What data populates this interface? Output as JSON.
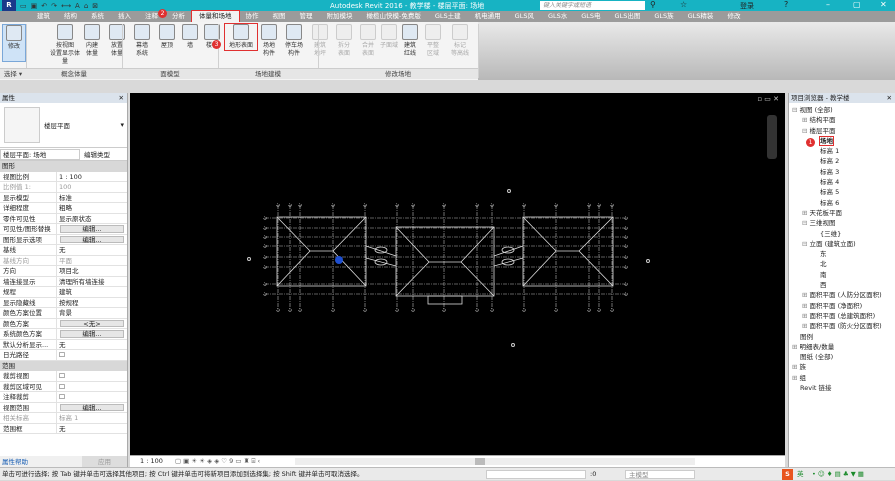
{
  "titlebar": {
    "title": "Autodesk Revit 2016 -    教学楼 - 楼层平面: 场地",
    "search_placeholder": "键入关键字或短语",
    "login": "登录",
    "app_letter": "R"
  },
  "tabs": [
    "建筑",
    "结构",
    "系统",
    "插入",
    "注释",
    "分析",
    "体量和场地",
    "协作",
    "视图",
    "管理",
    "附加模块",
    "橄榄山快模-免费版",
    "GLS土建",
    "机电通用",
    "GLS风",
    "GLS水",
    "GLS电",
    "GLS出图",
    "GLS族",
    "GLS精装",
    "修改"
  ],
  "active_tab": "体量和场地",
  "ribbon": {
    "buttons": [
      {
        "label": "修改"
      },
      {
        "label": "按视图\n设置显示体量"
      },
      {
        "label": "内建\n体量"
      },
      {
        "label": "放置\n体量"
      },
      {
        "label": "幕墙\n系统"
      },
      {
        "label": "屋顶"
      },
      {
        "label": "墙"
      },
      {
        "label": "楼板"
      },
      {
        "label": "地形表面"
      },
      {
        "label": "场地\n构件"
      },
      {
        "label": "停车场\n构件"
      },
      {
        "label": "建筑\n地坪"
      },
      {
        "label": "拆分\n表面"
      },
      {
        "label": "合并\n表面"
      },
      {
        "label": "子面域"
      },
      {
        "label": "建筑\n红线"
      },
      {
        "label": "平整\n区域"
      },
      {
        "label": "标记\n等高线"
      }
    ],
    "panels": [
      "选择 ▾",
      "概念体量",
      "面模型",
      "场地建模",
      "修改场地"
    ]
  },
  "annotations": [
    "1",
    "2",
    "3"
  ],
  "properties": {
    "header": "属性",
    "type_name": "楼层平面",
    "instance": "楼层平面: 场地",
    "edit_type": "编辑类型",
    "section_graphics": "图形",
    "rows": [
      {
        "k": "视图比例",
        "v": "1 : 100"
      },
      {
        "k": "比例值 1:",
        "v": "100",
        "g": true
      },
      {
        "k": "显示模型",
        "v": "标准"
      },
      {
        "k": "详细程度",
        "v": "粗略"
      },
      {
        "k": "零件可见性",
        "v": "显示原状态"
      },
      {
        "k": "可见性/图形替换",
        "b": "编辑..."
      },
      {
        "k": "图形显示选项",
        "b": "编辑..."
      },
      {
        "k": "基线",
        "v": "无"
      },
      {
        "k": "基线方向",
        "v": "平面",
        "g": true
      },
      {
        "k": "方向",
        "v": "项目北"
      },
      {
        "k": "墙连接显示",
        "v": "清理所有墙连接"
      },
      {
        "k": "规程",
        "v": "建筑"
      },
      {
        "k": "显示隐藏线",
        "v": "按规程"
      },
      {
        "k": "颜色方案位置",
        "v": "背景"
      },
      {
        "k": "颜色方案",
        "b": "<无>"
      },
      {
        "k": "系统颜色方案",
        "b": "编辑..."
      },
      {
        "k": "默认分析显示...",
        "v": "无"
      },
      {
        "k": "日光路径",
        "v": "☐"
      }
    ],
    "section_extents": "范围",
    "rows2": [
      {
        "k": "裁剪视图",
        "v": "☐"
      },
      {
        "k": "裁剪区域可见",
        "v": "☐"
      },
      {
        "k": "注释裁剪",
        "v": "☐"
      },
      {
        "k": "视图范围",
        "b": "编辑..."
      },
      {
        "k": "相关标高",
        "v": "标高 1",
        "g": true
      },
      {
        "k": "范围框",
        "v": "无"
      }
    ],
    "help": "属性帮助",
    "apply": "应用"
  },
  "viewbar": {
    "scale": "1 : 100"
  },
  "status": {
    "text": "单击可进行选择; 按 Tab 键并单击可选择其他项目; 按 Ctrl 键并单击可将新项目添加到选择集; 按 Shift 键并单击可取消选择。",
    "worksets": ":0",
    "model": "主模型",
    "ime": "英"
  },
  "browser": {
    "header": "项目浏览器 - 教学楼",
    "items": [
      {
        "t": "视图 (全部)",
        "l": 0,
        "e": "⊟"
      },
      {
        "t": "结构平面",
        "l": 1,
        "e": "⊞"
      },
      {
        "t": "楼层平面",
        "l": 1,
        "e": "⊟"
      },
      {
        "t": "场地",
        "l": 2,
        "sel": true
      },
      {
        "t": "标高 1",
        "l": 2
      },
      {
        "t": "标高 2",
        "l": 2
      },
      {
        "t": "标高 3",
        "l": 2
      },
      {
        "t": "标高 4",
        "l": 2
      },
      {
        "t": "标高 5",
        "l": 2
      },
      {
        "t": "标高 6",
        "l": 2
      },
      {
        "t": "天花板平面",
        "l": 1,
        "e": "⊞"
      },
      {
        "t": "三维视图",
        "l": 1,
        "e": "⊟"
      },
      {
        "t": "{三维}",
        "l": 2
      },
      {
        "t": "立面 (建筑立面)",
        "l": 1,
        "e": "⊟"
      },
      {
        "t": "东",
        "l": 2
      },
      {
        "t": "北",
        "l": 2
      },
      {
        "t": "南",
        "l": 2
      },
      {
        "t": "西",
        "l": 2
      },
      {
        "t": "面积平面 (人防分区面积)",
        "l": 1,
        "e": "⊞"
      },
      {
        "t": "面积平面 (净面积)",
        "l": 1,
        "e": "⊞"
      },
      {
        "t": "面积平面 (总建筑面积)",
        "l": 1,
        "e": "⊞"
      },
      {
        "t": "面积平面 (防火分区面积)",
        "l": 1,
        "e": "⊞"
      },
      {
        "t": "图例",
        "l": 0
      },
      {
        "t": "明细表/数量",
        "l": 0,
        "e": "⊞"
      },
      {
        "t": "图纸 (全部)",
        "l": 0
      },
      {
        "t": "族",
        "l": 0,
        "e": "⊞"
      },
      {
        "t": "组",
        "l": 0,
        "e": "⊞"
      },
      {
        "t": "Revit 链接",
        "l": 0
      }
    ]
  },
  "colors": {
    "titlebar": "#17b3c3",
    "highlight": "#e03030",
    "canvas": "#000000",
    "selection": "#1e4fd0"
  }
}
